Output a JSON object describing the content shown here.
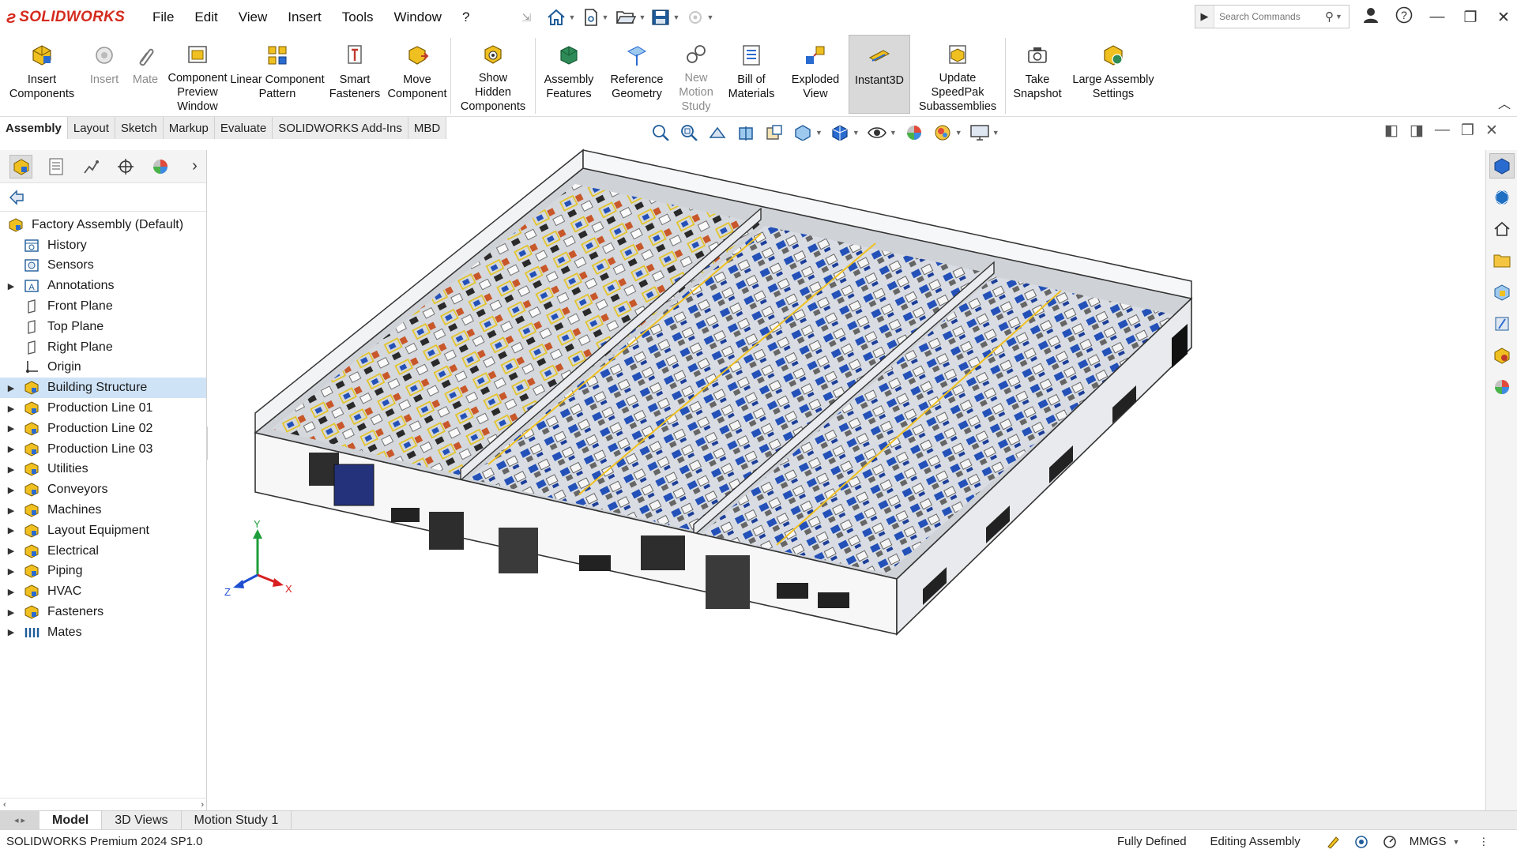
{
  "app": {
    "brand": "SOLIDWORKS",
    "brand_color": "#d52b1e"
  },
  "menu": [
    "File",
    "Edit",
    "View",
    "Insert",
    "Tools",
    "Window",
    "?"
  ],
  "search": {
    "placeholder": "Search Commands"
  },
  "ribbon": {
    "insert_components": "Insert\nComponents",
    "insert": "Insert",
    "mate": "Mate",
    "component_preview": "Component\nPreview\nWindow",
    "linear_pattern": "Linear Component\nPattern",
    "smart_fasteners": "Smart\nFasteners",
    "move_component": "Move\nComponent",
    "show_hidden": "Show\nHidden\nComponents",
    "assembly_features": "Assembly\nFeatures",
    "reference_geometry": "Reference\nGeometry",
    "new_motion_study": "New\nMotion\nStudy",
    "bom": "Bill of\nMaterials",
    "exploded_view": "Exploded\nView",
    "instant3d": "Instant3D",
    "update_speedpak": "Update\nSpeedPak\nSubassemblies",
    "take_snapshot": "Take\nSnapshot",
    "large_assembly": "Large Assembly\nSettings"
  },
  "tabs": [
    "Assembly",
    "Layout",
    "Sketch",
    "Markup",
    "Evaluate",
    "SOLIDWORKS Add-Ins",
    "MBD"
  ],
  "tree": {
    "root": "Factory Assembly  (Default)",
    "items": [
      "History",
      "Sensors",
      "Annotations",
      "Front Plane",
      "Top Plane",
      "Right Plane",
      "Origin",
      "Building Structure",
      "Production Line 01",
      "Production Line 02",
      "Production Line 03",
      "Utilities",
      "Conveyors",
      "Machines",
      "Layout Equipment",
      "Electrical",
      "Piping",
      "HVAC",
      "Fasteners",
      "Mates"
    ]
  },
  "triad": {
    "x": "X",
    "y": "Y",
    "z": "Z"
  },
  "bottom_tabs": [
    "Model",
    "3D Views",
    "Motion Study 1"
  ],
  "status": {
    "version": "SOLIDWORKS Premium 2024 SP1.0",
    "state": "Fully Defined",
    "mode": "Editing Assembly",
    "units": "MMGS"
  }
}
